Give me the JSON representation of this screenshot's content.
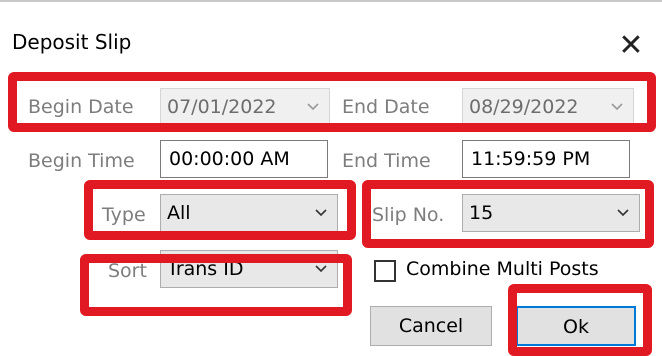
{
  "window": {
    "title": "Deposit Slip",
    "close_glyph": "✕"
  },
  "dates": {
    "begin_label": "Begin Date",
    "begin_value": "07/01/2022",
    "end_label": "End Date",
    "end_value": "08/29/2022"
  },
  "times": {
    "begin_label": "Begin Time",
    "begin_value": "00:00:00 AM",
    "end_label": "End Time",
    "end_value": "11:59:59 PM"
  },
  "type": {
    "label": "Type",
    "value": "All"
  },
  "slip": {
    "label": "Slip No.",
    "value": "15"
  },
  "sort": {
    "label": "Sort",
    "value": "Trans ID"
  },
  "combine": {
    "label": "Combine Multi Posts",
    "checked": false
  },
  "buttons": {
    "cancel": "Cancel",
    "ok": "Ok"
  },
  "colors": {
    "highlight": "#e01923",
    "accent": "#0078d7"
  },
  "icons": [
    "close-icon",
    "chevron-down-icon",
    "checkbox-icon"
  ]
}
